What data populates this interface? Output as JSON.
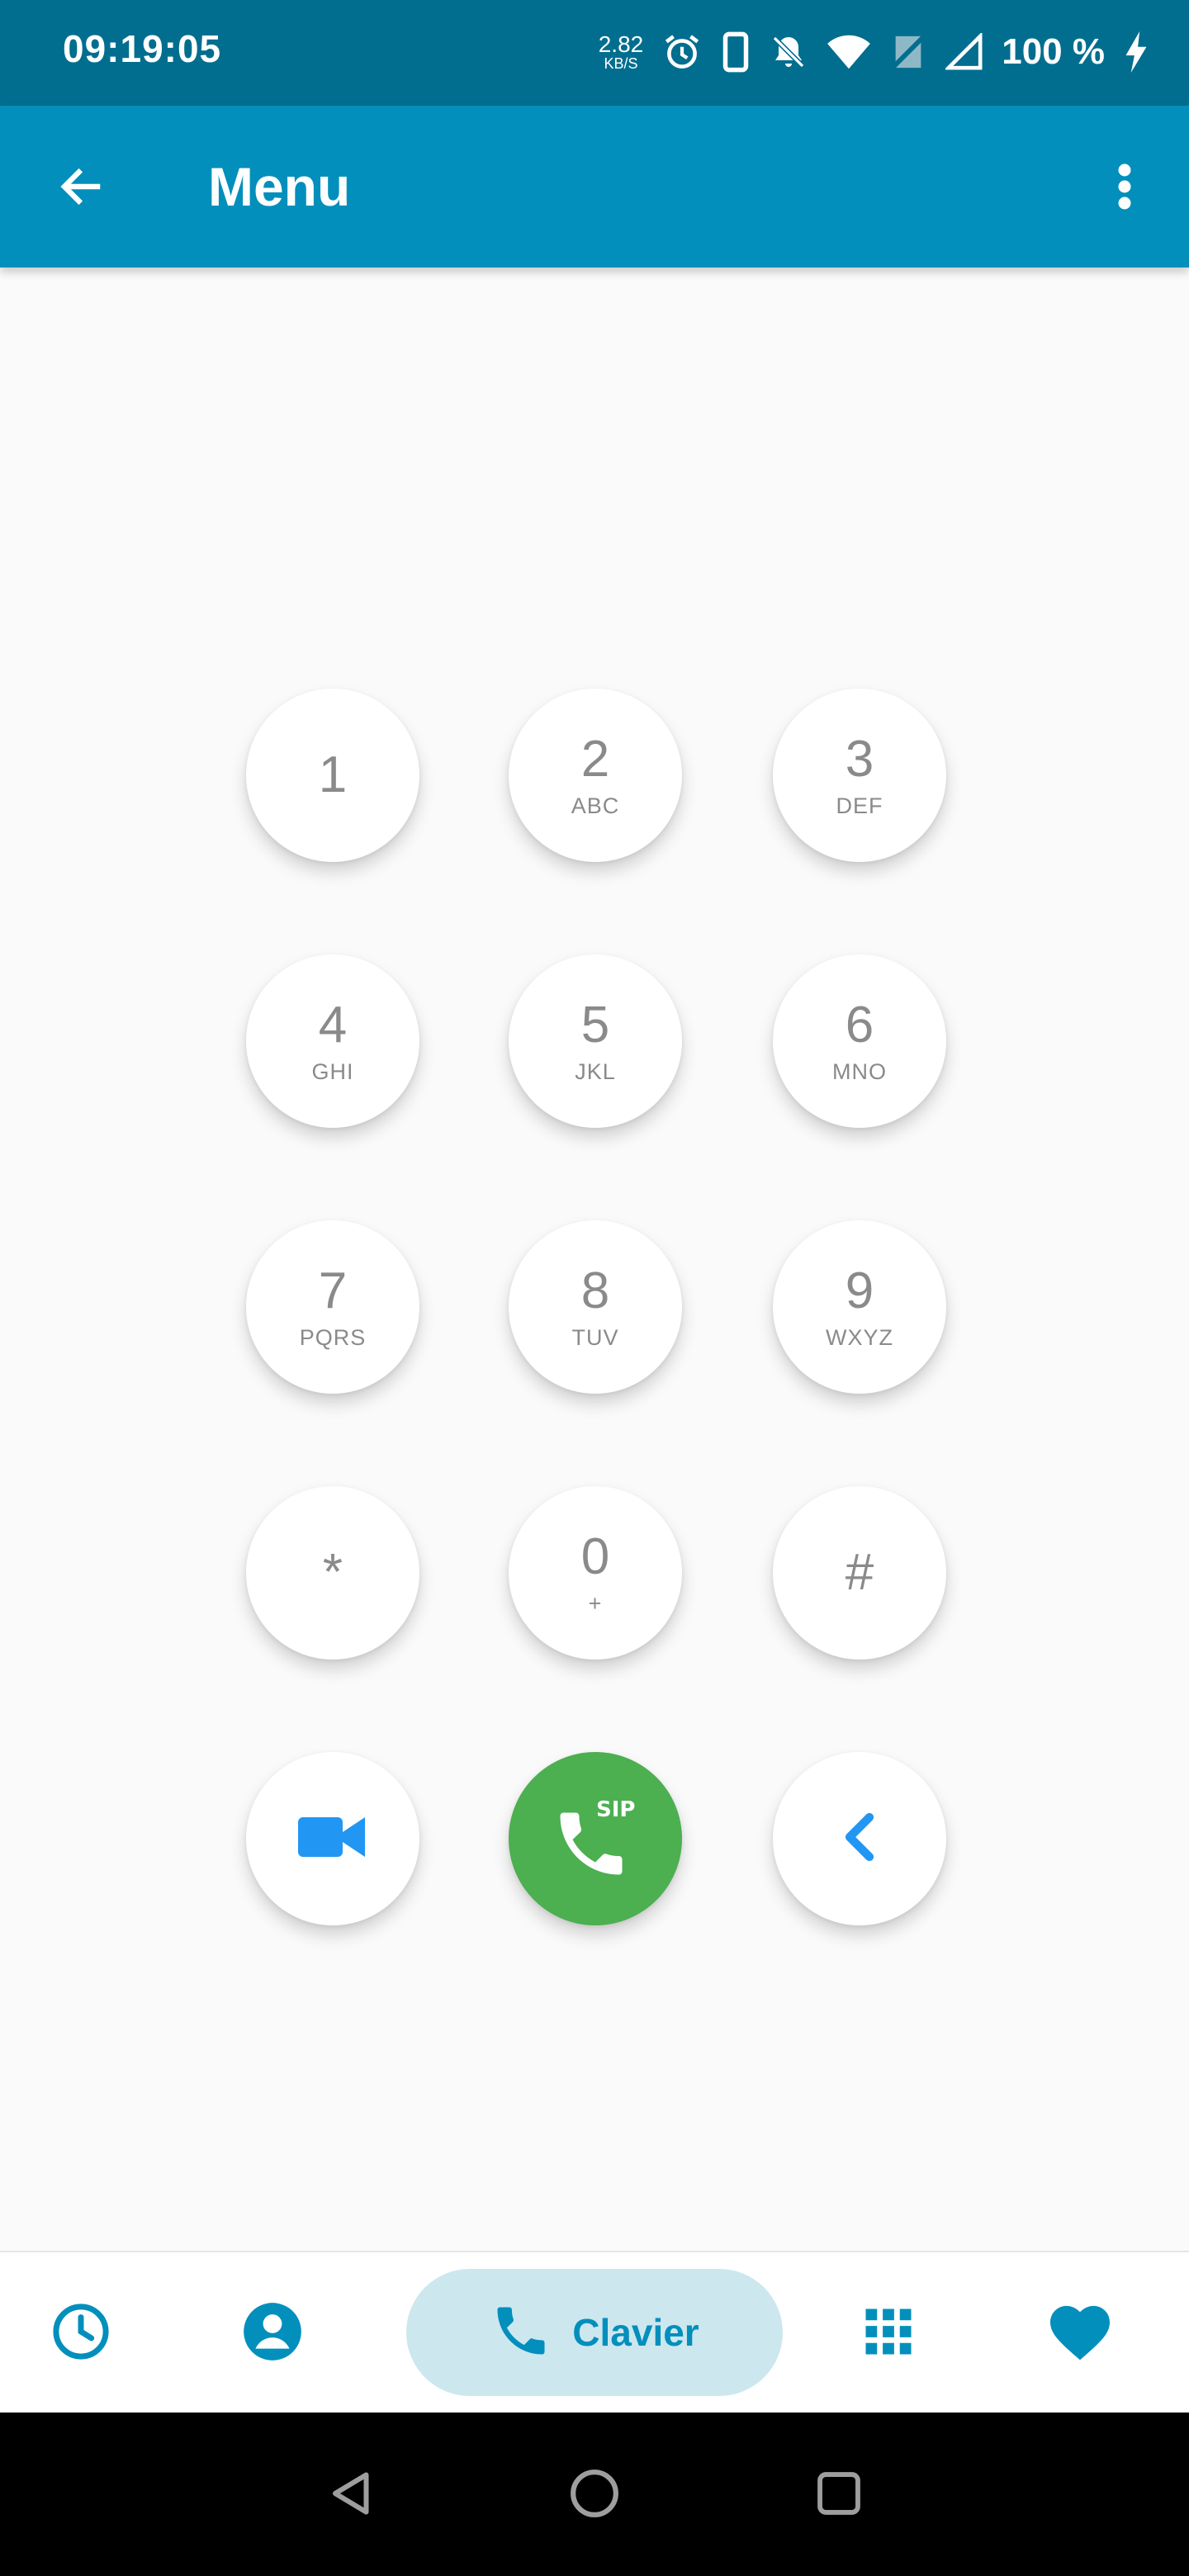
{
  "status_bar": {
    "time": "09:19:05",
    "speed_value": "2.82",
    "speed_unit": "KB/S",
    "battery": "100 %",
    "icons": [
      "alarm-icon",
      "phone-icon",
      "bell-off-icon",
      "wifi-icon",
      "no-sim-icon",
      "signal-icon",
      "charging-icon"
    ]
  },
  "app_bar": {
    "title": "Menu",
    "back_icon": "arrow-back-icon",
    "overflow_icon": "more-vert-icon"
  },
  "keypad": {
    "keys": [
      {
        "digit": "1",
        "letters": ""
      },
      {
        "digit": "2",
        "letters": "ABC"
      },
      {
        "digit": "3",
        "letters": "DEF"
      },
      {
        "digit": "4",
        "letters": "GHI"
      },
      {
        "digit": "5",
        "letters": "JKL"
      },
      {
        "digit": "6",
        "letters": "MNO"
      },
      {
        "digit": "7",
        "letters": "PQRS"
      },
      {
        "digit": "8",
        "letters": "TUV"
      },
      {
        "digit": "9",
        "letters": "WXYZ"
      },
      {
        "digit": "*",
        "letters": ""
      },
      {
        "digit": "0",
        "letters": "+"
      },
      {
        "digit": "#",
        "letters": ""
      }
    ],
    "actions": {
      "video_icon": "videocam-icon",
      "call_icon": "sip-call-icon",
      "call_badge": "SIP",
      "backspace_icon": "chevron-left-icon"
    }
  },
  "bottom_nav": {
    "items": [
      {
        "icon": "history-icon"
      },
      {
        "icon": "contacts-icon"
      },
      {
        "icon": "phone-icon",
        "label": "Clavier",
        "active": true
      },
      {
        "icon": "dialpad-icon"
      },
      {
        "icon": "favorites-heart-icon"
      }
    ]
  },
  "system_nav": [
    "back-triangle-icon",
    "home-circle-icon",
    "recents-square-icon"
  ],
  "colors": {
    "status_bar": "#026e8f",
    "app_bar": "#038fbc",
    "accent": "#038fbc",
    "call_green": "#4caf50",
    "video_blue": "#2196f3",
    "pill_bg": "#cde7ef",
    "background": "#fafafa"
  }
}
